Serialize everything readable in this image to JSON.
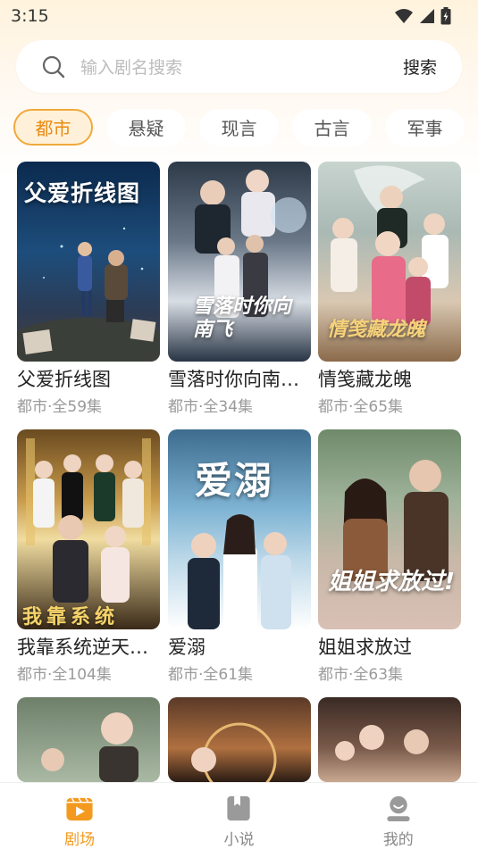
{
  "status_bar": {
    "time": "3:15"
  },
  "search": {
    "placeholder": "输入剧名搜索",
    "button_label": "搜索"
  },
  "categories": [
    {
      "label": "都市",
      "active": true
    },
    {
      "label": "悬疑",
      "active": false
    },
    {
      "label": "现言",
      "active": false
    },
    {
      "label": "古言",
      "active": false
    },
    {
      "label": "军事",
      "active": false
    }
  ],
  "dramas": [
    {
      "title": "父爱折线图",
      "meta": "都市·全59集",
      "poster_text": "父爱折线图"
    },
    {
      "title": "雪落时你向南…",
      "meta": "都市·全34集",
      "poster_text": "雪落时你向南飞"
    },
    {
      "title": "情笺藏龙魄",
      "meta": "都市·全65集",
      "poster_text": "情笺藏龙魄"
    },
    {
      "title": "我靠系统逆天…",
      "meta": "都市·全104集",
      "poster_text": "我靠系统"
    },
    {
      "title": "爱溺",
      "meta": "都市·全61集",
      "poster_text": "爱溺"
    },
    {
      "title": "姐姐求放过",
      "meta": "都市·全63集",
      "poster_text": "姐姐求放过!"
    }
  ],
  "bottom_nav": [
    {
      "label": "剧场",
      "icon": "theater-icon",
      "active": true
    },
    {
      "label": "小说",
      "icon": "book-icon",
      "active": false
    },
    {
      "label": "我的",
      "icon": "profile-icon",
      "active": false
    }
  ],
  "colors": {
    "accent": "#f39a1e",
    "chip_active_bg": "#fff1d9"
  }
}
